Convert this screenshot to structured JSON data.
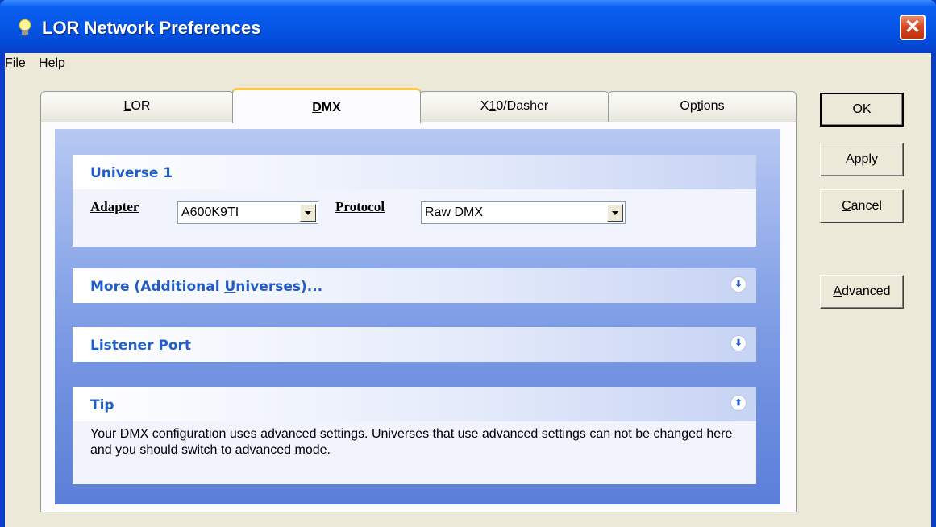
{
  "window": {
    "title": "LOR Network Preferences",
    "close_label": "✕"
  },
  "menu": [
    {
      "label": "File",
      "mnemonic": "F",
      "rest": "ile"
    },
    {
      "label": "Help",
      "mnemonic": "H",
      "rest": "elp"
    }
  ],
  "tabs": [
    {
      "label": "LOR",
      "pre": "",
      "mn": "L",
      "post": "OR",
      "active": false
    },
    {
      "label": "DMX",
      "pre": "",
      "mn": "D",
      "post": "MX",
      "active": true
    },
    {
      "label": "X10/Dasher",
      "pre": "X",
      "mn": "1",
      "post": "0/Dasher",
      "active": false
    },
    {
      "label": "Options",
      "pre": "Op",
      "mn": "t",
      "post": "ions",
      "active": false
    }
  ],
  "universe": {
    "title": "Universe 1",
    "adapter_label": "Adapter",
    "adapter_value": "A600K9TI",
    "protocol_label": "Protocol",
    "protocol_value": "Raw DMX"
  },
  "more_group": {
    "pre": "More (Additional ",
    "mn": "U",
    "post": "niverses)..."
  },
  "listener_group": {
    "pre": "",
    "mn": "L",
    "post": "istener Port"
  },
  "tip_group": {
    "title": "Tip",
    "text": "Your DMX configuration uses advanced settings.  Universes that use advanced settings can not be changed here and you should switch to advanced mode."
  },
  "buttons": {
    "ok": {
      "mn": "O",
      "post": "K"
    },
    "apply": {
      "label": "Apply"
    },
    "cancel": {
      "mn": "C",
      "post": "ancel"
    },
    "advanced": {
      "mn": "A",
      "post": "dvanced"
    }
  },
  "icons": {
    "app": "lightbulb-icon",
    "expand": "double-chevron-down-icon",
    "collapse": "double-chevron-up-icon"
  },
  "colors": {
    "titlebar": "#0a5ff0",
    "group_title": "#215dc6",
    "active_tab_accent": "#ffc83c",
    "close": "#d64524"
  }
}
